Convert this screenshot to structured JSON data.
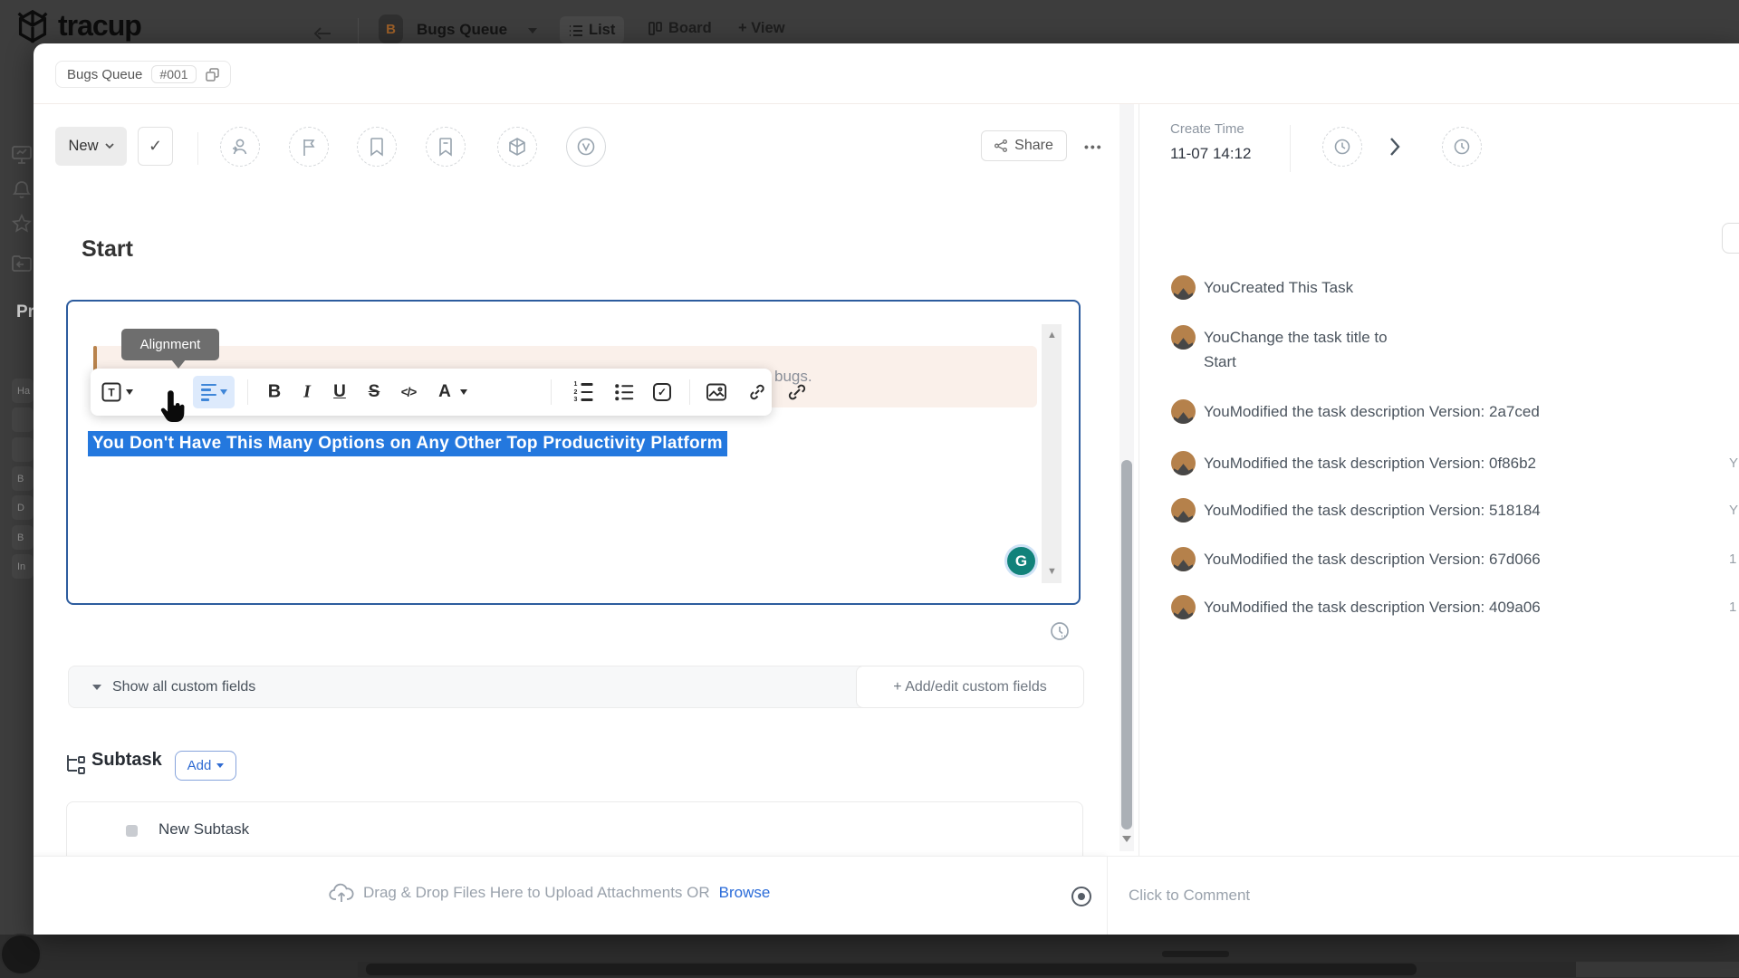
{
  "app": {
    "logo": "tracup"
  },
  "topbar": {
    "project_tab": "Bugs Queue",
    "project_initial": "B",
    "list_tab": "List",
    "board_tab": "Board",
    "view_tab": "+ View"
  },
  "sidebar": {
    "section_label": "Pr",
    "chips": [
      "Ha",
      "",
      "",
      "B",
      "D",
      "B",
      "In"
    ]
  },
  "task": {
    "list_name": "Bugs Queue",
    "task_id": "#001",
    "status": "New",
    "share": "Share",
    "more": "•••",
    "create_time_label": "Create Time",
    "create_time_value": "11-07 14:12",
    "title": "Start"
  },
  "editor": {
    "tooltip": "Alignment",
    "glyphs": {
      "text_style": "T",
      "bold": "B",
      "italic": "I",
      "underline": "U",
      "strikethrough": "S",
      "code": "</>",
      "color": "A"
    },
    "quote_visible": "bugs.",
    "selected_text": "You Don't Have This Many Options on Any Other Top Productivity Platform",
    "grammarly": "G"
  },
  "fields": {
    "show": "Show all custom fields",
    "add": "+ Add/edit custom fields"
  },
  "subtask": {
    "title": "Subtask",
    "add": "Add",
    "new_item": "New Subtask"
  },
  "attachments": {
    "drag": "Drag & Drop Files Here to Upload Attachments OR",
    "browse": "Browse"
  },
  "comment": {
    "placeholder": "Click to Comment"
  },
  "activity": [
    {
      "text": "YouCreated This Task",
      "line2": "",
      "edge": ""
    },
    {
      "text": "YouChange the task title to",
      "line2": "Start",
      "edge": ""
    },
    {
      "text": "YouModified the task description Version: 2a7ced",
      "line2": "",
      "edge": ""
    },
    {
      "text": "YouModified the task description Version: 0f86b2",
      "line2": "",
      "edge": "Y"
    },
    {
      "text": "YouModified the task description Version: 518184",
      "line2": "",
      "edge": "Y"
    },
    {
      "text": "YouModified the task description Version: 67d066",
      "line2": "",
      "edge": "1"
    },
    {
      "text": "YouModified the task description Version: 409a06",
      "line2": "",
      "edge": "1"
    }
  ],
  "colors": {
    "accent_blue": "#2e6cd9",
    "selection_blue": "#2478de",
    "editor_border": "#2d5c9e",
    "quote_bg": "#faf0ea",
    "quote_bar": "#b9834c",
    "grammarly_teal": "#11827a"
  }
}
